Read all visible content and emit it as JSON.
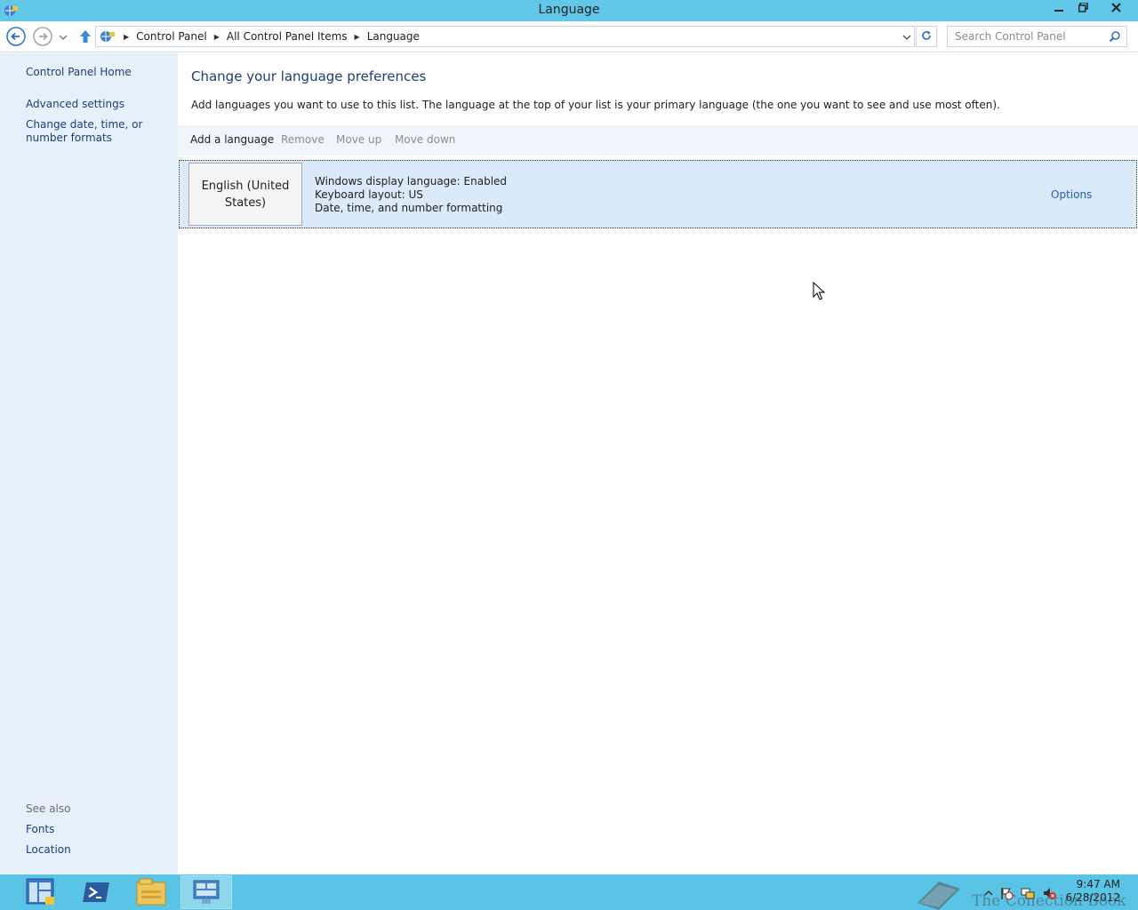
{
  "window": {
    "title": "Language",
    "minimize_icon": "minimize-icon",
    "maximize_icon": "restore-icon",
    "close_icon": "close-icon"
  },
  "address": {
    "breadcrumbs": [
      "Control Panel",
      "All Control Panel Items",
      "Language"
    ],
    "search_placeholder": "Search Control Panel"
  },
  "sidebar": {
    "home": "Control Panel Home",
    "items": [
      "Advanced settings",
      "Change date, time, or number formats"
    ],
    "see_also_label": "See also",
    "see_also": [
      "Fonts",
      "Location"
    ]
  },
  "main": {
    "heading": "Change your language preferences",
    "description": "Add languages you want to use to this list. The language at the top of your list is your primary language (the one you want to see and use most often).",
    "toolbar": {
      "add": "Add a language",
      "remove": "Remove",
      "move_up": "Move up",
      "move_down": "Move down"
    },
    "languages": [
      {
        "name": "English (United States)",
        "details": [
          "Windows display language: Enabled",
          "Keyboard layout: US",
          "Date, time, and number formatting"
        ],
        "options": "Options"
      }
    ]
  },
  "taskbar": {
    "items": [
      "server-manager-icon",
      "powershell-icon",
      "file-explorer-icon",
      "control-panel-icon"
    ],
    "clock_time": "9:47 AM",
    "clock_date": "6/28/2012",
    "watermark": "The Collection Book"
  },
  "colors": {
    "titlebar": "#62c8ea",
    "sidebar": "#e5f0fb",
    "taskbar": "#5ac4e6",
    "link": "#1e3d7a",
    "selected_row": "#dbeafb"
  }
}
